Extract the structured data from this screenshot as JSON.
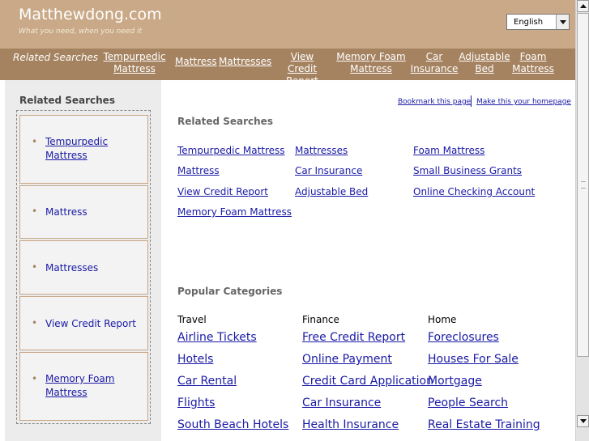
{
  "header": {
    "site_title": "Matthewdong.com",
    "tagline": "What you need, when you need it",
    "language": "English"
  },
  "nav": {
    "label": "Related Searches",
    "links": [
      {
        "line1": "Tempurpedic",
        "line2": "Mattress"
      },
      {
        "line1": "Mattress",
        "line2": ""
      },
      {
        "line1": "Mattresses",
        "line2": ""
      },
      {
        "line1": "View Credit",
        "line2": "Report"
      },
      {
        "line1": "Memory Foam",
        "line2": "Mattress"
      },
      {
        "line1": "Car",
        "line2": "Insurance"
      },
      {
        "line1": "Adjustable",
        "line2": "Bed"
      },
      {
        "line1": "Foam",
        "line2": "Mattress"
      }
    ]
  },
  "sidebar": {
    "title": "Related Searches",
    "items": [
      {
        "line1": "Tempurpedic",
        "line2": "Mattress"
      },
      {
        "line1": "Mattress",
        "line2": ""
      },
      {
        "line1": "Mattresses",
        "line2": ""
      },
      {
        "line1": "View Credit Report",
        "line2": ""
      },
      {
        "line1": "Memory Foam",
        "line2": "Mattress"
      }
    ]
  },
  "top_links": {
    "bookmark": "Bookmark this page",
    "homepage": "Make this your homepage"
  },
  "related": {
    "title": "Related Searches",
    "links": [
      "Tempurpedic Mattress",
      "Mattresses",
      "Foam Mattress",
      "Mattress",
      "Car Insurance",
      "Small Business Grants",
      "View Credit Report",
      "Adjustable Bed",
      "Online Checking Account",
      "Memory Foam Mattress"
    ]
  },
  "popular": {
    "title": "Popular Categories",
    "columns": [
      {
        "heading": "Travel",
        "links": [
          "Airline Tickets",
          "Hotels",
          "Car Rental",
          "Flights",
          "South Beach Hotels"
        ]
      },
      {
        "heading": "Finance",
        "links": [
          "Free Credit Report",
          "Online Payment",
          "Credit Card Application",
          "Car Insurance",
          "Health Insurance"
        ]
      },
      {
        "heading": "Home",
        "links": [
          "Foreclosures",
          "Houses For Sale",
          "Mortgage",
          "People Search",
          "Real Estate Training"
        ]
      }
    ]
  },
  "colors": {
    "header_bg": "#c9a987",
    "nav_bg": "#a58260",
    "link": "#1a1aa6"
  }
}
